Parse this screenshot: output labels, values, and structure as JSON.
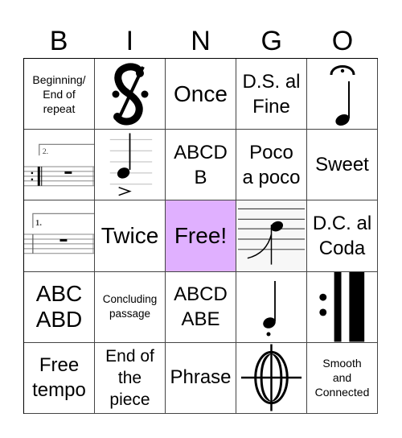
{
  "header": {
    "letters": [
      "B",
      "I",
      "N",
      "G",
      "O"
    ]
  },
  "colors": {
    "free_cell": "#e0b0ff",
    "grid_line": "#444444",
    "text": "#000000"
  },
  "cells": {
    "r0c0": {
      "label": "Beginning/\nEnd of\nrepeat"
    },
    "r0c1": {
      "icon": "dal-segno-sign-icon"
    },
    "r0c2": {
      "label": "Once"
    },
    "r0c3": {
      "label": "D.S. al\nFine"
    },
    "r0c4": {
      "icon": "fermata-quarter-note-icon"
    },
    "r1c0": {
      "icon": "second-ending-bracket-icon",
      "ending_number": "2."
    },
    "r1c1": {
      "icon": "accent-quarter-note-icon"
    },
    "r1c2": {
      "label": "ABCD\nB"
    },
    "r1c3": {
      "label": "Poco\na poco"
    },
    "r1c4": {
      "label": "Sweet"
    },
    "r2c0": {
      "icon": "first-ending-bracket-icon",
      "ending_number": "1."
    },
    "r2c1": {
      "label": "Twice"
    },
    "r2c2": {
      "label": "Free!"
    },
    "r2c3": {
      "icon": "slurred-note-on-staff-icon"
    },
    "r2c4": {
      "label": "D.C. al\nCoda"
    },
    "r3c0": {
      "label": "ABC\nABD"
    },
    "r3c1": {
      "label": "Concluding\npassage"
    },
    "r3c2": {
      "label": "ABCD\nABE"
    },
    "r3c3": {
      "icon": "staccato-quarter-note-icon"
    },
    "r3c4": {
      "icon": "repeat-sign-icon"
    },
    "r4c0": {
      "label": "Free\ntempo"
    },
    "r4c1": {
      "label": "End of\nthe\npiece"
    },
    "r4c2": {
      "label": "Phrase"
    },
    "r4c3": {
      "icon": "coda-sign-icon"
    },
    "r4c4": {
      "label": "Smooth\nand\nConnected"
    }
  }
}
